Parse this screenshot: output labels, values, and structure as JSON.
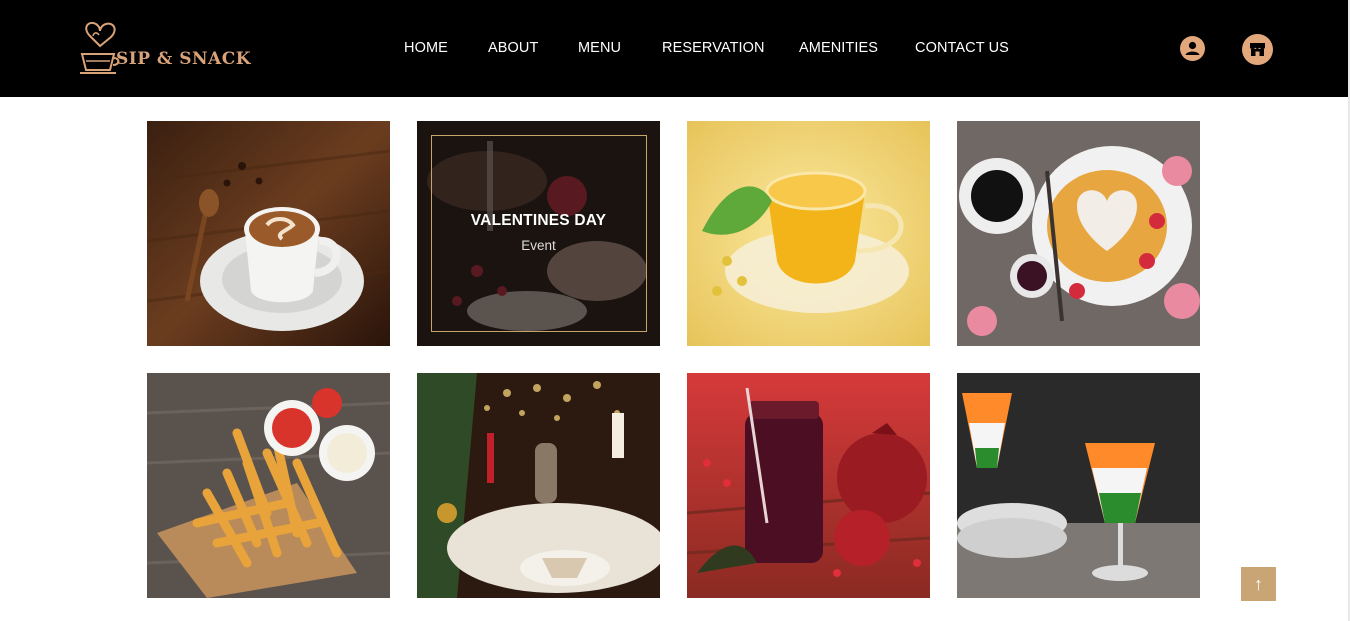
{
  "brand": {
    "name": "SIP & SNACK",
    "accent": "#d9a37a"
  },
  "nav": {
    "items": [
      "HOME",
      "ABOUT",
      "MENU",
      "RESERVATION",
      "AMENITIES",
      "CONTACT US"
    ]
  },
  "header_icons": [
    "user-icon",
    "store-icon"
  ],
  "gallery": {
    "items": [
      {
        "name": "cappuccino-image"
      },
      {
        "name": "valentines-image",
        "overlay_title": "VALENTINES DAY",
        "overlay_sub": "Event"
      },
      {
        "name": "green-tea-image"
      },
      {
        "name": "mothers-day-breakfast-image"
      },
      {
        "name": "french-fries-image"
      },
      {
        "name": "christmas-dinner-image"
      },
      {
        "name": "pomegranate-juice-image"
      },
      {
        "name": "tricolor-drinks-image"
      }
    ]
  },
  "back_to_top": {
    "glyph": "↑"
  }
}
